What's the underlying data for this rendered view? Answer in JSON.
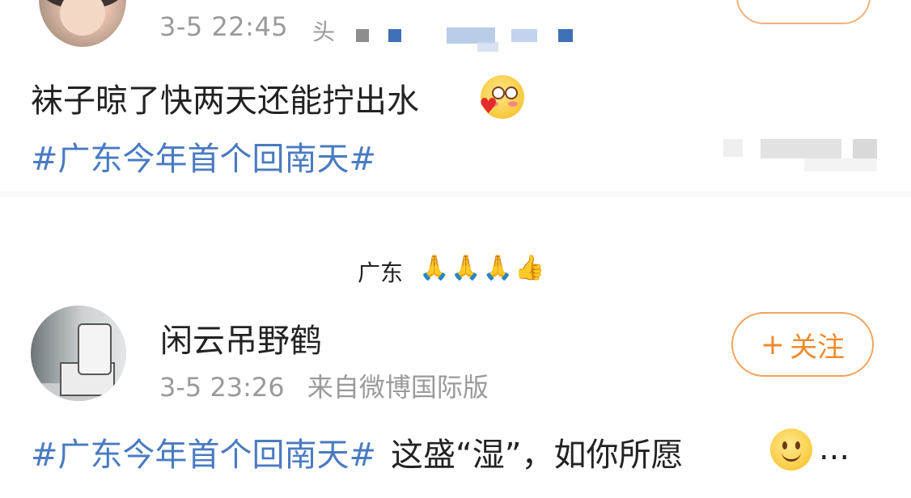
{
  "post1": {
    "timestamp": "3-5 22:45",
    "source_partial": "头",
    "text": "袜子晾了快两天还能拧出水",
    "emoji": "blushing-heart-emoji",
    "hashtag": "#广东今年首个回南天#"
  },
  "reply": {
    "text": "广东",
    "emojis": "🙏🙏🙏👍"
  },
  "post2": {
    "username": "闲云吊野鹤",
    "timestamp": "3-5 23:26",
    "source": "来自微博国际版",
    "follow_label": "关注",
    "follow_plus": "+",
    "hashtag": "#广东今年首个回南天#",
    "text": "这盛“湿”，如你所愿",
    "ellipsis": "...",
    "emoji": "smile-emoji"
  },
  "colors": {
    "hashtag": "#4a7bc1",
    "follow_accent": "#f08a2c",
    "meta_gray": "#9a9a9a"
  }
}
